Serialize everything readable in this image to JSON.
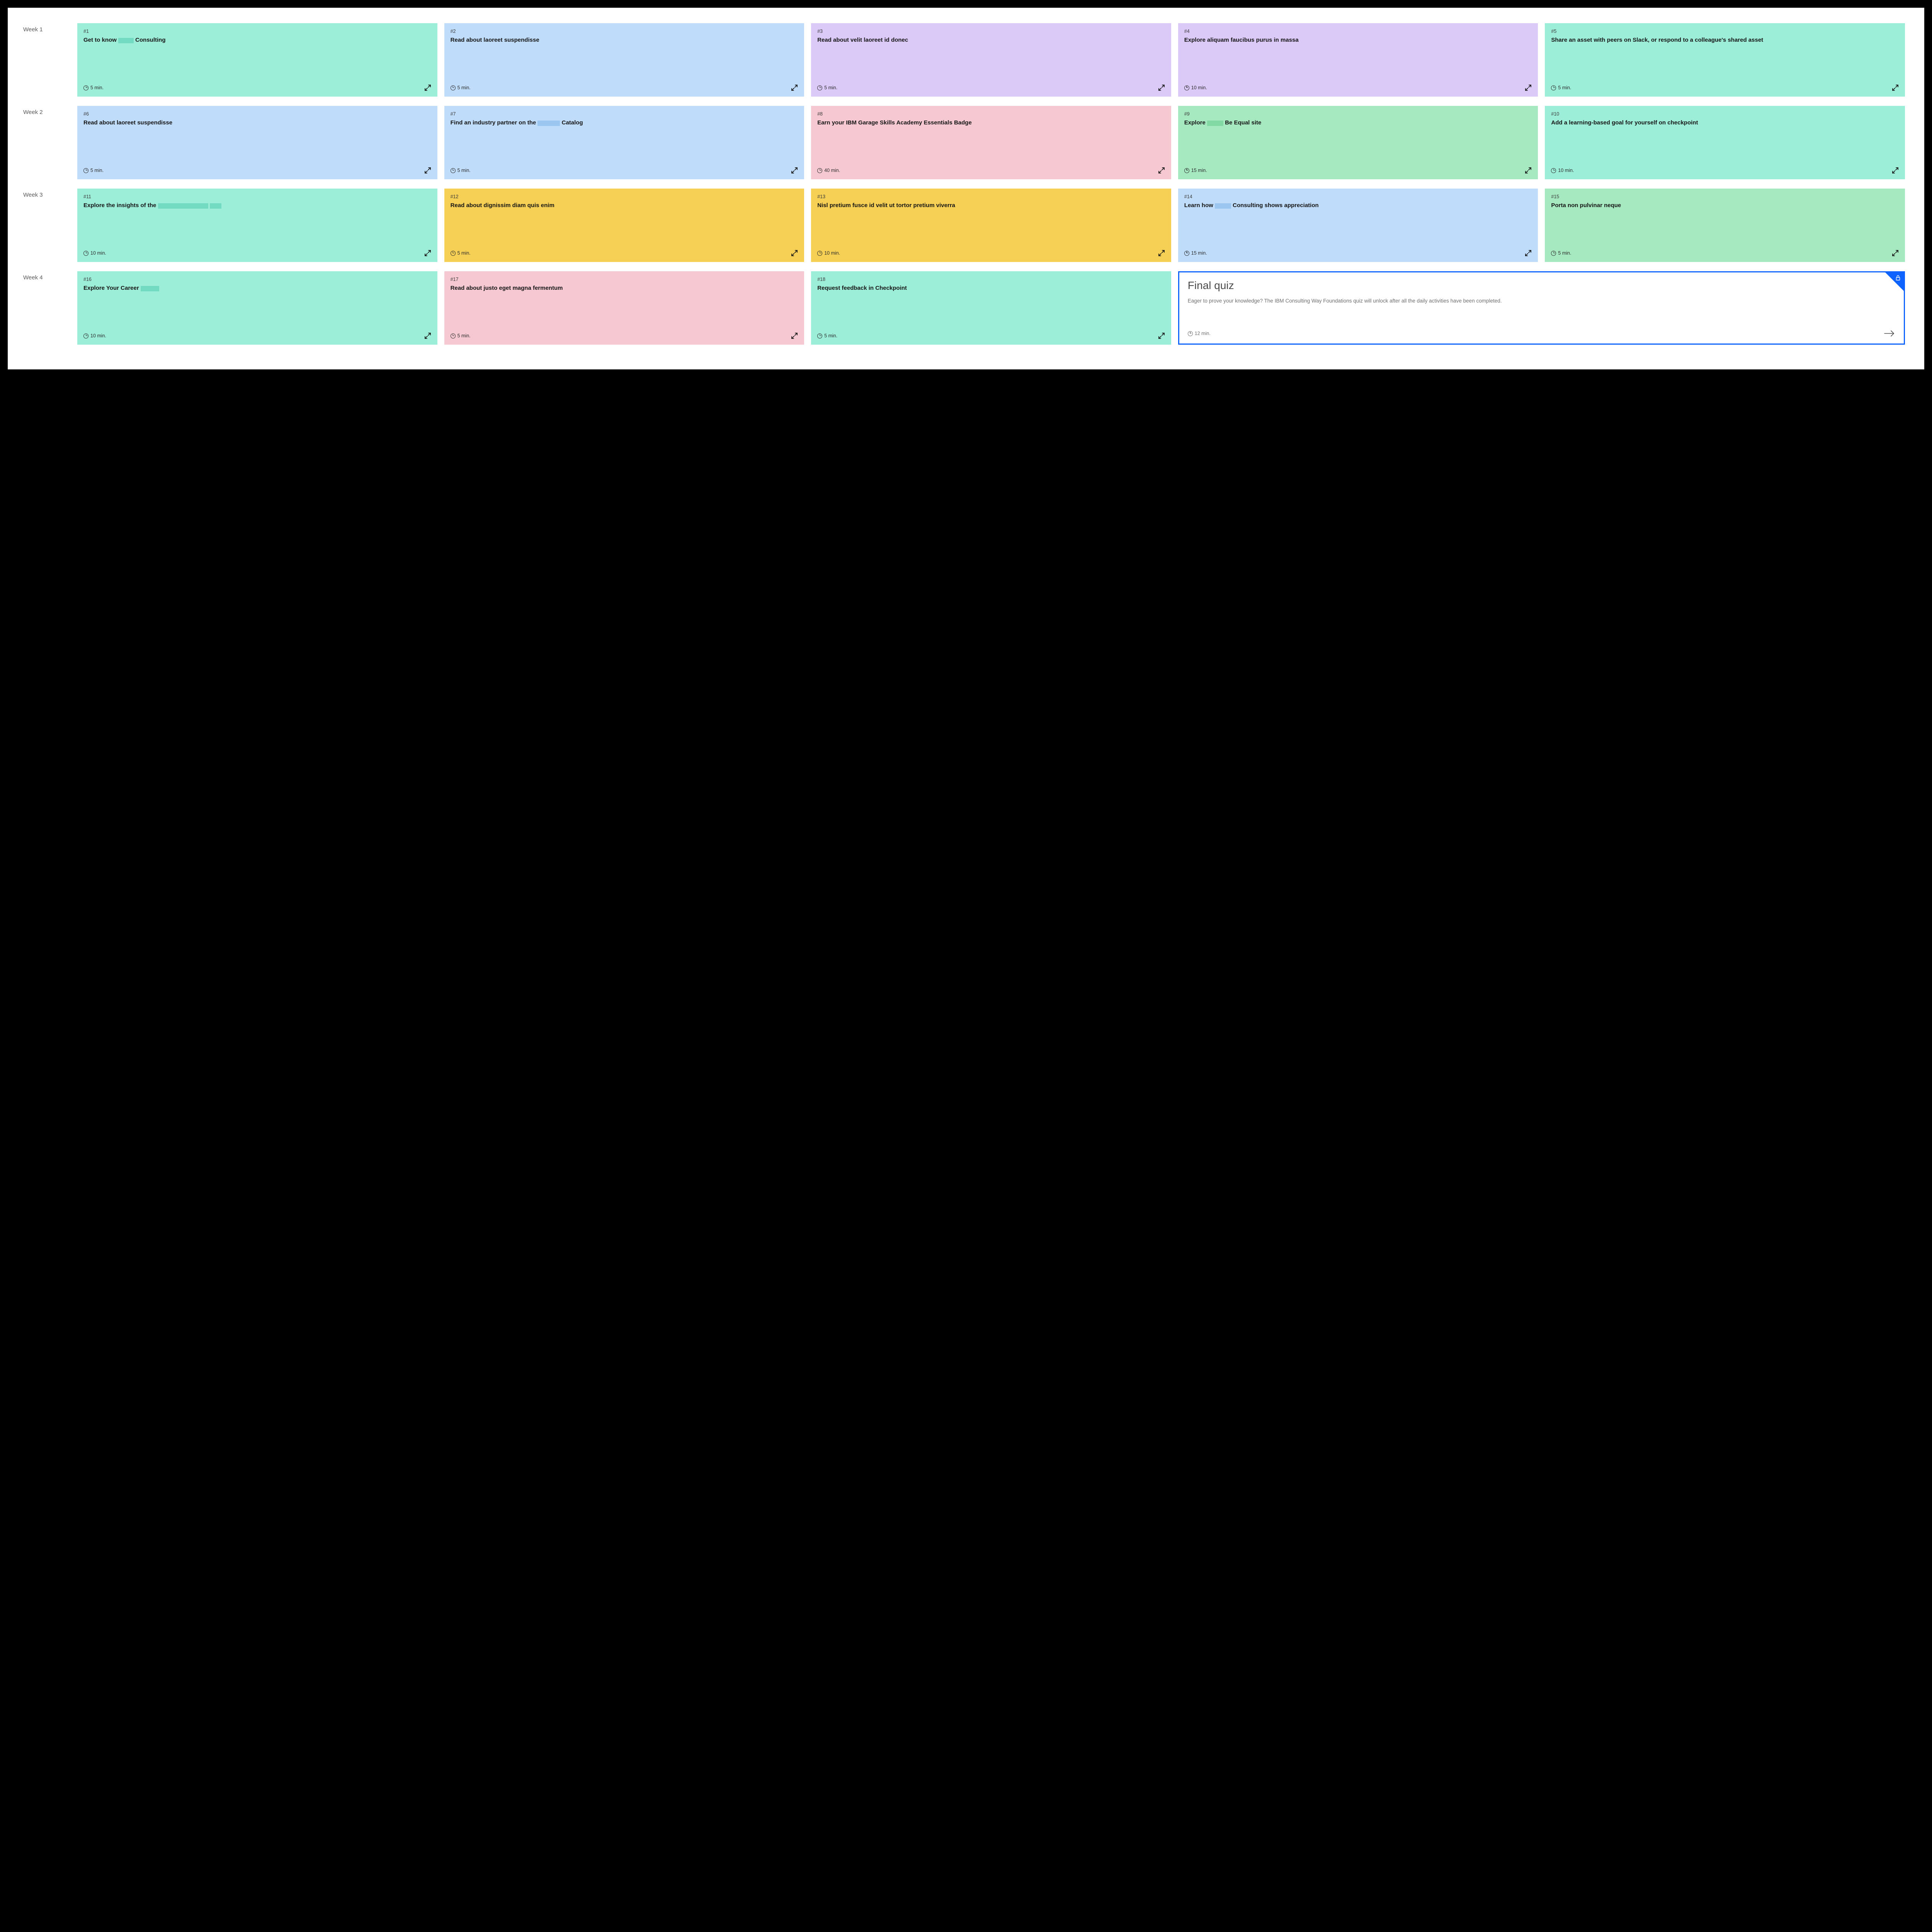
{
  "weeks": [
    {
      "label": "Week 1",
      "cards": [
        {
          "num": "#1",
          "title_parts": [
            "Get to know ",
            {
              "redact": 40
            },
            " Consulting"
          ],
          "duration": "5 min.",
          "color": "c-teal"
        },
        {
          "num": "#2",
          "title": "Read about laoreet suspendisse",
          "duration": "5 min.",
          "color": "c-blue"
        },
        {
          "num": "#3",
          "title": "Read about velit laoreet id donec",
          "duration": "5 min.",
          "color": "c-purple"
        },
        {
          "num": "#4",
          "title": "Explore aliquam faucibus purus in massa",
          "duration": "10 min.",
          "color": "c-purple"
        },
        {
          "num": "#5",
          "title": "Share an asset with peers on Slack, or respond to a colleague's shared asset",
          "duration": "5 min.",
          "color": "c-teal"
        }
      ]
    },
    {
      "label": "Week 2",
      "cards": [
        {
          "num": "#6",
          "title": "Read about laoreet suspendisse",
          "duration": "5 min.",
          "color": "c-blue"
        },
        {
          "num": "#7",
          "title_parts": [
            "Find an industry partner on the ",
            {
              "redact": 58
            },
            " Catalog"
          ],
          "duration": "5 min.",
          "color": "c-blue"
        },
        {
          "num": "#8",
          "title": "Earn your IBM Garage Skills Academy Essentials Badge",
          "duration": "40 min.",
          "color": "c-pink"
        },
        {
          "num": "#9",
          "title_parts": [
            "Explore ",
            {
              "redact": 42
            },
            " Be Equal site"
          ],
          "duration": "15 min.",
          "color": "c-green"
        },
        {
          "num": "#10",
          "title": "Add a learning-based goal for yourself on checkpoint",
          "duration": "10 min.",
          "color": "c-teal"
        }
      ]
    },
    {
      "label": "Week 3",
      "cards": [
        {
          "num": "#11",
          "title_parts": [
            "Explore the insights of the ",
            {
              "redact": 130
            },
            " ",
            {
              "redact": 30
            }
          ],
          "duration": "10 min.",
          "color": "c-teal"
        },
        {
          "num": "#12",
          "title": "Read about dignissim diam quis enim",
          "duration": "5 min.",
          "color": "c-yellow"
        },
        {
          "num": "#13",
          "title": "Nisl pretium fusce id velit ut tortor pretium viverra",
          "duration": "10 min.",
          "color": "c-yellow"
        },
        {
          "num": "#14",
          "title_parts": [
            "Learn how ",
            {
              "redact": 42
            },
            " Consulting shows appreciation"
          ],
          "duration": "15 min.",
          "color": "c-blue"
        },
        {
          "num": "#15",
          "title": "Porta non pulvinar neque",
          "duration": "5 min.",
          "color": "c-green"
        }
      ]
    },
    {
      "label": "Week 4",
      "cards": [
        {
          "num": "#16",
          "title_parts": [
            "Explore Your Career ",
            {
              "redact": 48
            }
          ],
          "duration": "10 min.",
          "color": "c-teal"
        },
        {
          "num": "#17",
          "title": "Read about justo eget magna fermentum",
          "duration": "5 min.",
          "color": "c-pink"
        },
        {
          "num": "#18",
          "title": "Request feedback in Checkpoint",
          "duration": "5 min.",
          "color": "c-teal"
        }
      ],
      "quiz": {
        "title": "Final quiz",
        "desc": "Eager to prove your knowledge? The IBM Consulting Way Foundations quiz will unlock after all the daily activities have been completed.",
        "duration": "12 min."
      }
    }
  ]
}
